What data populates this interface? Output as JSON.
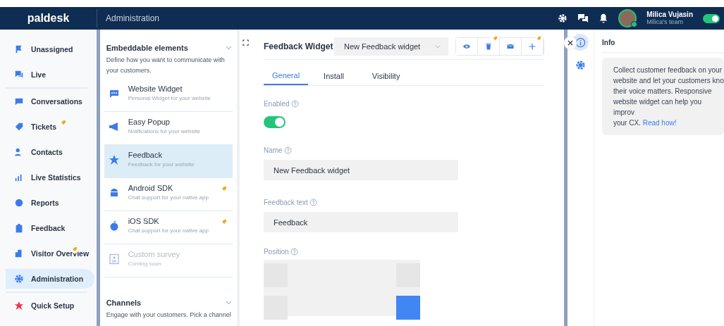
{
  "topbar": {
    "logo": "paldesk",
    "section": "Administration",
    "user": {
      "name": "Milica Vujasin",
      "team": "Milica's team",
      "online": true
    },
    "status_toggle": {
      "on": true
    }
  },
  "nav": {
    "groups": [
      {
        "items": [
          {
            "label": "Unassigned",
            "selected": false,
            "badge": false
          },
          {
            "label": "Live",
            "selected": false,
            "badge": false
          }
        ]
      },
      {
        "items": [
          {
            "label": "Conversations",
            "selected": false,
            "badge": false
          },
          {
            "label": "Tickets",
            "selected": false,
            "badge": true
          },
          {
            "label": "Contacts",
            "selected": false,
            "badge": false
          },
          {
            "label": "Live Statistics",
            "selected": false,
            "badge": false
          },
          {
            "label": "Reports",
            "selected": false,
            "badge": false
          },
          {
            "label": "Feedback",
            "selected": false,
            "badge": false
          },
          {
            "label": "Visitor Overview",
            "selected": false,
            "badge": true
          },
          {
            "label": "Administration",
            "selected": true,
            "badge": false
          }
        ]
      },
      {
        "items": [
          {
            "label": "Quick Setup",
            "selected": false,
            "badge": false
          }
        ]
      }
    ]
  },
  "elements": {
    "sections": [
      {
        "title": "Embeddable elements",
        "description": "Define how you want to communicate with your customers.",
        "expanded": true,
        "items": [
          {
            "title": "Website Widget",
            "subtitle": "Personal Widget for your website",
            "selected": false,
            "badge": false,
            "disabled": false
          },
          {
            "title": "Easy Popup",
            "subtitle": "Notifications for your website",
            "selected": false,
            "badge": false,
            "disabled": false
          },
          {
            "title": "Feedback",
            "subtitle": "Feedback for your website",
            "selected": true,
            "badge": false,
            "disabled": false
          },
          {
            "title": "Android SDK",
            "subtitle": "Chat support for your native app",
            "selected": false,
            "badge": true,
            "disabled": false
          },
          {
            "title": "iOS SDK",
            "subtitle": "Chat support for your native app",
            "selected": false,
            "badge": true,
            "disabled": false
          },
          {
            "title": "Custom survey",
            "subtitle": "Coming soon",
            "selected": false,
            "badge": false,
            "disabled": true
          }
        ]
      },
      {
        "title": "Channels",
        "description": "Engage with your customers. Pick a channel",
        "expanded": true
      }
    ]
  },
  "editor": {
    "title": "Feedback Widget",
    "widget_select": {
      "value": "New Feedback widget"
    },
    "actions": [
      {
        "badge": false
      },
      {
        "badge": true
      },
      {
        "badge": false
      },
      {
        "badge": true
      }
    ],
    "tabs": [
      {
        "label": "General",
        "selected": true
      },
      {
        "label": "Install",
        "selected": false
      },
      {
        "label": "Visibility",
        "selected": false
      }
    ],
    "enabled": {
      "label": "Enabled",
      "on": true
    },
    "name": {
      "label": "Name",
      "value": "New Feedback widget"
    },
    "feedback_text": {
      "label": "Feedback text",
      "value": "Feedback"
    },
    "position": {
      "label": "Position",
      "options": [
        {
          "selected": false
        },
        {
          "selected": false
        },
        {
          "selected": false
        },
        {
          "selected": true
        }
      ]
    }
  },
  "info": {
    "title": "Info",
    "tabs": [
      {
        "selected": true
      },
      {
        "selected": false
      }
    ],
    "text": "Collect customer feedback on your\nwebsite and let your customers kno\ntheir voice matters. Responsive\nwebsite widget can help you improv\nyour CX.",
    "link": "Read how!"
  }
}
